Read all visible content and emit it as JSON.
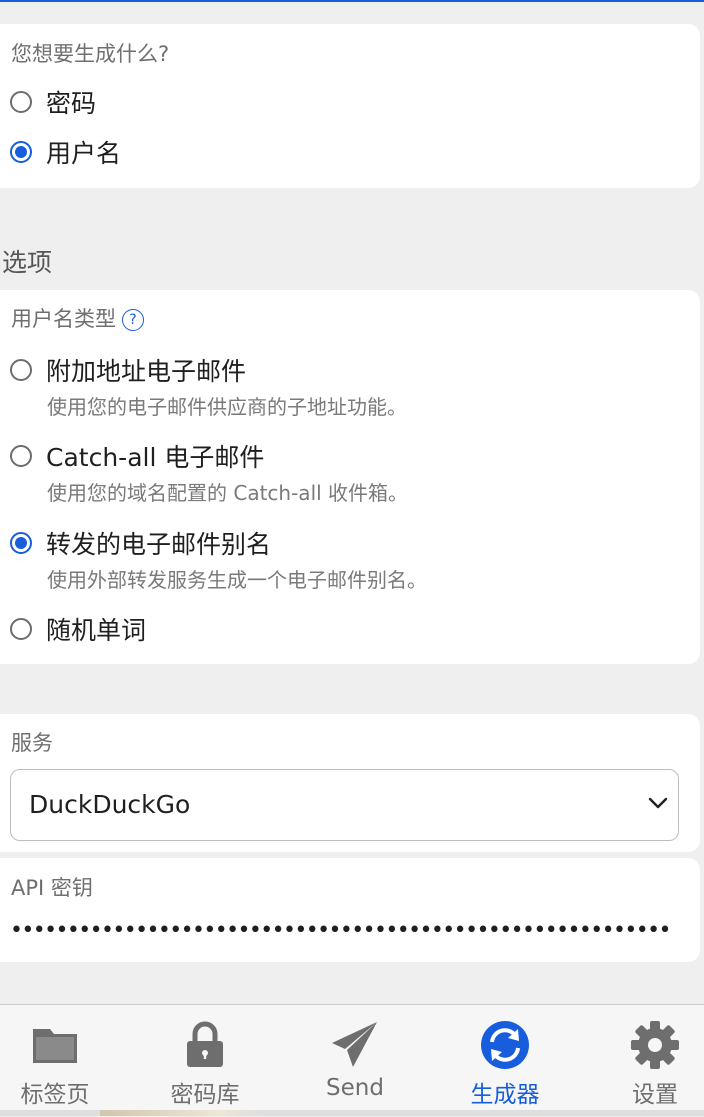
{
  "generate": {
    "label": "您想要生成什么?",
    "options": [
      {
        "label": "密码",
        "checked": false
      },
      {
        "label": "用户名",
        "checked": true
      }
    ]
  },
  "options_section": {
    "title": "选项",
    "username_type_label": "用户名类型",
    "help_icon": "question-circle-icon",
    "types": [
      {
        "label": "附加地址电子邮件",
        "desc": "使用您的电子邮件供应商的子地址功能。",
        "checked": false
      },
      {
        "label": "Catch-all 电子邮件",
        "desc": "使用您的域名配置的 Catch-all 收件箱。",
        "checked": false
      },
      {
        "label": "转发的电子邮件别名",
        "desc": "使用外部转发服务生成一个电子邮件别名。",
        "checked": true
      },
      {
        "label": "随机单词",
        "desc": "",
        "checked": false
      }
    ]
  },
  "service": {
    "label": "服务",
    "value": "DuckDuckGo"
  },
  "api_key": {
    "label": "API 密钥",
    "value": "••••••••••••••••••••••••••••••••••••••••••••••••••••••••••"
  },
  "tabbar": {
    "tabs": [
      {
        "label": "标签页",
        "icon": "folder-icon",
        "active": false
      },
      {
        "label": "密码库",
        "icon": "lock-icon",
        "active": false
      },
      {
        "label": "Send",
        "icon": "paper-plane-icon",
        "active": false
      },
      {
        "label": "生成器",
        "icon": "refresh-icon",
        "active": true
      },
      {
        "label": "设置",
        "icon": "gear-icon",
        "active": false
      }
    ]
  },
  "colors": {
    "accent": "#175ddc",
    "background": "#efefef",
    "card": "#ffffff",
    "icon_gray": "#6e6e6e"
  }
}
